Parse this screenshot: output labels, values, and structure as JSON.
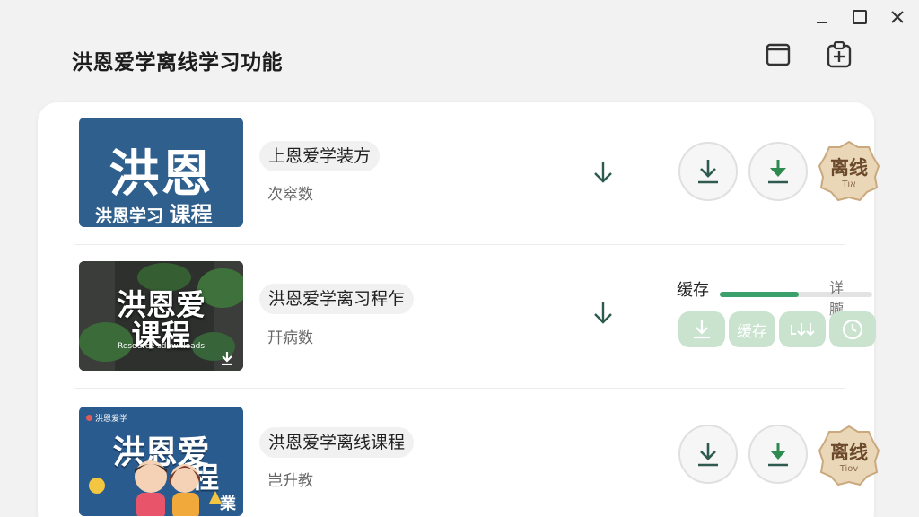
{
  "app": {
    "title": "洪恩爱学离线学习功能"
  },
  "colors": {
    "accent_green": "#3aa16a",
    "download_dark": "#2e5a50",
    "download_green": "#2f8a52",
    "badge_tan": "#d9bf98",
    "mini_btn_bg": "#c9e3cf"
  },
  "courses": [
    {
      "thumb_big": "洪恩",
      "thumb_small": "洪恩学习",
      "thumb_small2": "课程",
      "title": "上恩爱学装方",
      "subtitle": "次窣数",
      "badge_label": "离线",
      "badge_sub": "Tאו"
    },
    {
      "thumb_big": "洪恩爱",
      "thumb_big2": "课程",
      "thumb_caption": "Resource sdownloads",
      "title": "洪恩爱学离习稈乍",
      "subtitle": "幵病数",
      "cache_label": "缓存",
      "progress_text": "详朧",
      "progress": 0.52,
      "mini_buttons": [
        "",
        "缓存",
        "",
        ""
      ]
    },
    {
      "thumb_tag": "洪恩爱学",
      "thumb_big": "洪恩爱",
      "thumb_big2": "程",
      "thumb_corner": "業",
      "title": "洪恩爱学离线课程",
      "subtitle": "岂升教",
      "badge_label": "离线",
      "badge_sub": "Tiov"
    }
  ]
}
